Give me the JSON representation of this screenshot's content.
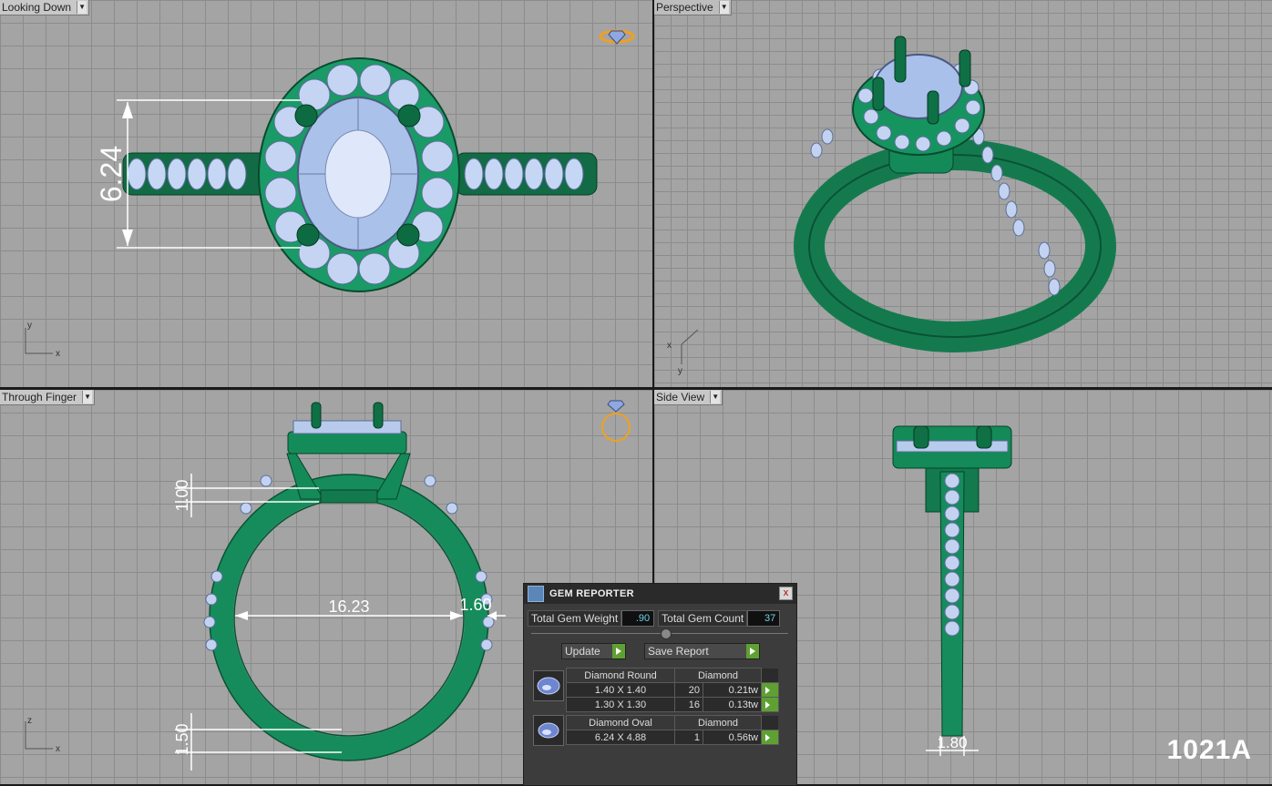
{
  "viewports": {
    "top": {
      "title": "Looking Down",
      "dim": "6.24",
      "axis_v": "y",
      "axis_h": "x"
    },
    "perspective": {
      "title": "Perspective",
      "axis_a": "x",
      "axis_b": "y"
    },
    "front": {
      "title": "Through Finger",
      "dim_gap": "1.00",
      "dim_inner": "16.23",
      "dim_band": "1.60",
      "dim_base": "1.50",
      "axis_v": "z",
      "axis_h": "x"
    },
    "side": {
      "title": "Side View",
      "dim_width": "1.80"
    }
  },
  "gem_reporter": {
    "title": "GEM REPORTER",
    "close": "x",
    "total_weight_label": "Total Gem Weight",
    "total_weight_value": ".90",
    "total_count_label": "Total Gem Count",
    "total_count_value": "37",
    "update_label": "Update",
    "save_label": "Save Report",
    "groups": [
      {
        "shape": "Diamond Round",
        "material": "Diamond",
        "rows": [
          {
            "size": "1.40 X 1.40",
            "count": "20",
            "weight": "0.21tw"
          },
          {
            "size": "1.30 X 1.30",
            "count": "16",
            "weight": "0.13tw"
          }
        ]
      },
      {
        "shape": "Diamond Oval",
        "material": "Diamond",
        "rows": [
          {
            "size": "6.24 X 4.88",
            "count": "1",
            "weight": "0.56tw"
          }
        ]
      }
    ]
  },
  "model_code": "1021A",
  "colors": {
    "metal": "#1e8a5e",
    "metal_dark": "#0d5a3a",
    "gem": "#b8cdf0",
    "accent": "#f0a020"
  },
  "icons": [
    "dropdown-arrow-icon",
    "ring-icon",
    "gem-icon",
    "close-icon",
    "go-arrow-icon"
  ]
}
